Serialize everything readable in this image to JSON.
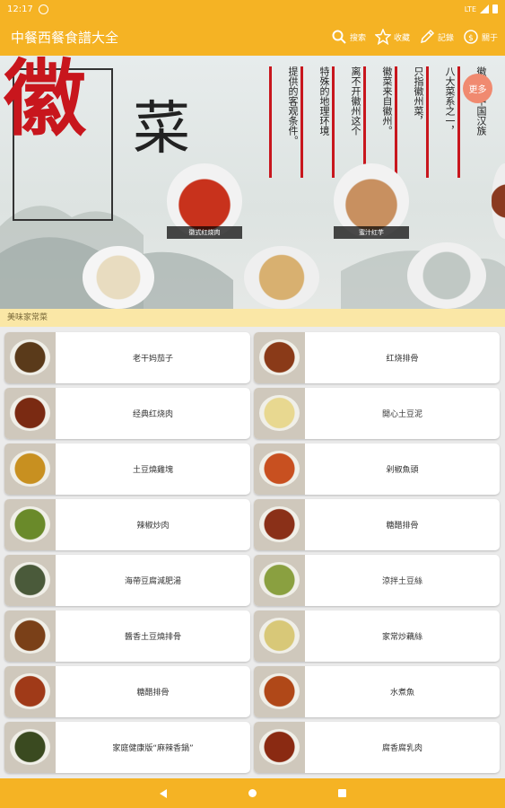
{
  "status_bar": {
    "time": "12:17",
    "network": "LTE"
  },
  "app_bar": {
    "title": "中餐西餐食譜大全",
    "actions": [
      {
        "label": "搜索",
        "icon": "search-icon"
      },
      {
        "label": "收藏",
        "icon": "star-icon"
      },
      {
        "label": "記錄",
        "icon": "pencil-icon"
      },
      {
        "label": "關于",
        "icon": "info-icon"
      }
    ]
  },
  "banner": {
    "big_char": "徽",
    "small_char": "菜",
    "columns": [
      "徽菜是中国汉族",
      "八大菜系之一，",
      "只指徽州菜，",
      "徽菜来自徽州。",
      "离不开徽州这个",
      "特殊的地理环境",
      "提供的客观条件。"
    ],
    "more_label": "更多",
    "dish_captions": [
      "徽式红烧肉",
      "蜜汁红芋"
    ]
  },
  "section_label": "美味家常菜",
  "recipes": [
    {
      "name": "老干妈茄子",
      "color": "#5a3a1a"
    },
    {
      "name": "红烧排骨",
      "color": "#8a3a18"
    },
    {
      "name": "经典红烧肉",
      "color": "#7a2a12"
    },
    {
      "name": "開心土豆泥",
      "color": "#e8d890"
    },
    {
      "name": "土豆燒雞塊",
      "color": "#c89020"
    },
    {
      "name": "剁椒魚頭",
      "color": "#c85020"
    },
    {
      "name": "辣椒炒肉",
      "color": "#6a8a2a"
    },
    {
      "name": "糖醋排骨",
      "color": "#8a3018"
    },
    {
      "name": "海帶豆腐減肥湯",
      "color": "#4a5a3a"
    },
    {
      "name": "涼拌土豆絲",
      "color": "#8aa040"
    },
    {
      "name": "醬香土豆燒排骨",
      "color": "#7a4018"
    },
    {
      "name": "家常炒藕絲",
      "color": "#d8c878"
    },
    {
      "name": "糖醋排骨",
      "color": "#a03a18"
    },
    {
      "name": "水煮魚",
      "color": "#b04818"
    },
    {
      "name": "家庭健康版“麻辣香鍋”",
      "color": "#3a4a20"
    },
    {
      "name": "腐香腐乳肉",
      "color": "#8a2a12"
    }
  ]
}
